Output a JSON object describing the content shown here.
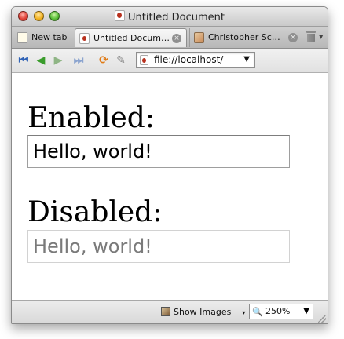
{
  "window": {
    "title": "Untitled Document"
  },
  "tabs": [
    {
      "label": "New tab",
      "icon": "document-icon"
    },
    {
      "label": "Untitled Docum…",
      "icon": "page-icon",
      "close": "×"
    },
    {
      "label": "Christopher Sc…",
      "icon": "image-icon",
      "close": "×"
    }
  ],
  "toolbar": {
    "first_icon": "⏮",
    "back_icon": "◀",
    "forward_icon": "▶",
    "last_icon": "⏭",
    "reload_icon": "⟳",
    "edit_icon": "✎",
    "url": "file://localhost/",
    "url_caret": "▼"
  },
  "content": {
    "enabled_heading": "Enabled:",
    "enabled_value": "Hello, world!",
    "disabled_heading": "Disabled:",
    "disabled_value": "Hello, world!"
  },
  "statusbar": {
    "show_images_label": "Show Images",
    "show_images_caret": "▾",
    "zoom_value": "250%",
    "zoom_caret": "▼",
    "zoom_icon": "🔍"
  }
}
